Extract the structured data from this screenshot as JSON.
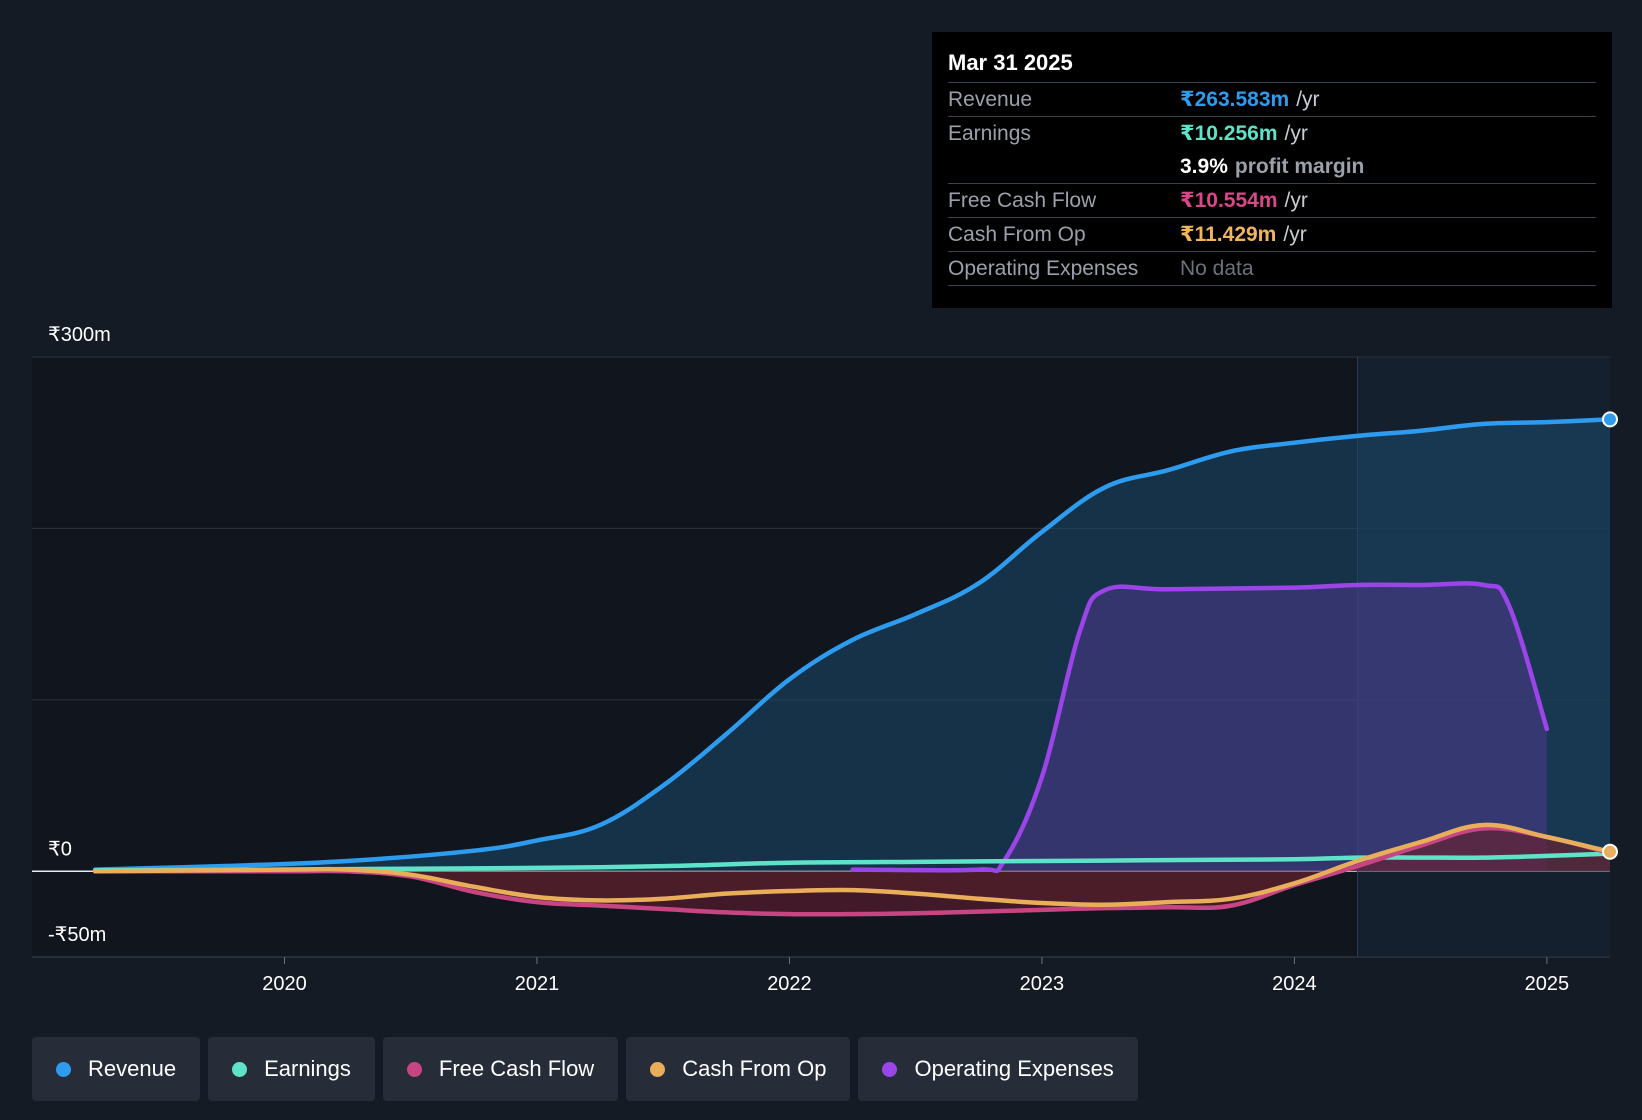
{
  "tooltip": {
    "date": "Mar 31 2025",
    "rows": [
      {
        "label": "Revenue",
        "value": "₹263.583m",
        "unit": "/yr",
        "color": "#2d9cef"
      },
      {
        "label": "Earnings",
        "value": "₹10.256m",
        "unit": "/yr",
        "color": "#5fe3c8"
      },
      {
        "label": "",
        "value": "3.9%",
        "unit": "profit margin",
        "color": "#ffffff"
      },
      {
        "label": "Free Cash Flow",
        "value": "₹10.554m",
        "unit": "/yr",
        "color": "#d9468a"
      },
      {
        "label": "Cash From Op",
        "value": "₹11.429m",
        "unit": "/yr",
        "color": "#f0b55d"
      },
      {
        "label": "Operating Expenses",
        "value": "No data",
        "unit": "",
        "color": "#6b727c"
      }
    ]
  },
  "legend": [
    {
      "label": "Revenue",
      "color": "#2d9cef"
    },
    {
      "label": "Earnings",
      "color": "#5fe3c8"
    },
    {
      "label": "Free Cash Flow",
      "color": "#c74583"
    },
    {
      "label": "Cash From Op",
      "color": "#e9ae5a"
    },
    {
      "label": "Operating Expenses",
      "color": "#9b45e9"
    }
  ],
  "chart_data": {
    "type": "area",
    "ylim": [
      -50,
      300
    ],
    "y_tick_labels": [
      {
        "value": 300,
        "label": "₹300m"
      },
      {
        "value": 0,
        "label": "₹0"
      },
      {
        "value": -50,
        "label": "-₹50m"
      }
    ],
    "y_gridlines": [
      300,
      200,
      100,
      0
    ],
    "xlim": [
      2019.0,
      2025.25
    ],
    "x_ticks": [
      {
        "value": 2020,
        "label": "2020"
      },
      {
        "value": 2021,
        "label": "2021"
      },
      {
        "value": 2022,
        "label": "2022"
      },
      {
        "value": 2023,
        "label": "2023"
      },
      {
        "value": 2024,
        "label": "2024"
      },
      {
        "value": 2025,
        "label": "2025"
      }
    ],
    "highlight_from": 2024.25,
    "series": [
      {
        "name": "Revenue",
        "color": "#2d9cef",
        "fill": true,
        "x": [
          2019.25,
          2019.75,
          2020.25,
          2020.75,
          2021.0,
          2021.25,
          2021.5,
          2021.75,
          2022.0,
          2022.25,
          2022.5,
          2022.75,
          2023.0,
          2023.25,
          2023.5,
          2023.75,
          2024.0,
          2024.25,
          2024.5,
          2024.75,
          2025.0,
          2025.25
        ],
        "y": [
          1,
          3,
          6,
          12,
          18,
          27,
          50,
          80,
          112,
          135,
          150,
          168,
          198,
          224,
          234,
          245,
          250,
          254,
          257,
          261,
          262,
          263.6
        ]
      },
      {
        "name": "Earnings",
        "color": "#5fe3c8",
        "fill": false,
        "x": [
          2019.25,
          2020.0,
          2020.5,
          2021.0,
          2021.5,
          2022.0,
          2022.5,
          2023.0,
          2023.5,
          2024.0,
          2024.25,
          2024.5,
          2024.75,
          2025.0,
          2025.25
        ],
        "y": [
          0.5,
          1,
          1.5,
          2,
          3,
          5,
          5.5,
          6,
          6.5,
          7,
          8,
          8,
          8,
          9,
          10.3
        ]
      },
      {
        "name": "Free Cash Flow",
        "color": "#c74583",
        "fill": true,
        "x": [
          2019.25,
          2020.0,
          2020.25,
          2020.5,
          2020.75,
          2021.0,
          2021.25,
          2021.5,
          2021.75,
          2022.0,
          2022.25,
          2022.5,
          2022.75,
          2023.0,
          2023.25,
          2023.5,
          2023.75,
          2024.0,
          2024.25,
          2024.5,
          2024.75,
          2025.0,
          2025.25
        ],
        "y": [
          0,
          0,
          0,
          -3,
          -12,
          -18,
          -20,
          -22,
          -24,
          -25,
          -25,
          -24.5,
          -23.5,
          -22.5,
          -21.5,
          -21,
          -20,
          -8,
          3,
          15,
          25,
          20,
          10.6
        ]
      },
      {
        "name": "Cash From Op",
        "color": "#e9ae5a",
        "fill": true,
        "x": [
          2019.25,
          2020.0,
          2020.25,
          2020.5,
          2020.75,
          2021.0,
          2021.25,
          2021.5,
          2021.75,
          2022.0,
          2022.25,
          2022.5,
          2022.75,
          2023.0,
          2023.25,
          2023.5,
          2023.75,
          2024.0,
          2024.25,
          2024.5,
          2024.75,
          2025.0,
          2025.25
        ],
        "y": [
          0,
          1,
          1,
          -2,
          -9,
          -15,
          -17,
          -16,
          -13,
          -11.5,
          -11,
          -13,
          -16,
          -18.5,
          -19.5,
          -18,
          -16,
          -7,
          6,
          17,
          27,
          20,
          11.4
        ]
      },
      {
        "name": "Operating Expenses",
        "color": "#9b45e9",
        "fill": true,
        "x": [
          2022.25,
          2022.75,
          2022.85,
          2023.0,
          2023.15,
          2023.25,
          2023.5,
          2024.0,
          2024.25,
          2024.5,
          2024.75,
          2024.85,
          2025.0
        ],
        "y": [
          1,
          1,
          6,
          55,
          140,
          164,
          164.5,
          165.5,
          167,
          167,
          167,
          155,
          83
        ]
      }
    ]
  }
}
